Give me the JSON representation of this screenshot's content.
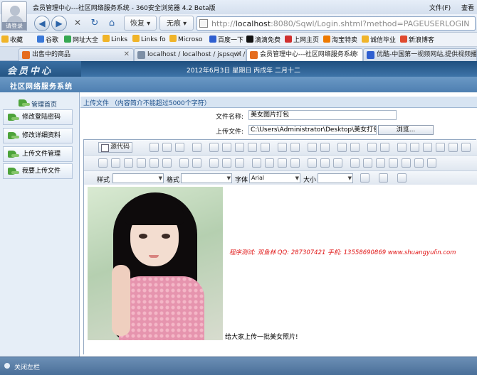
{
  "browser": {
    "title": "会员管理中心---社区网络服务系统 - 360安全浏览器 4.2 Beta版",
    "avatar_label": "请登录",
    "menu": [
      "文件(F)",
      "查看"
    ],
    "nav": {
      "back": "◀",
      "forward": "▶",
      "stop": "✕",
      "refresh": "↻",
      "home": "⌂",
      "restore_label": "恢复",
      "noimage_label": "无痕"
    },
    "url_prefix": "http://",
    "url_host": "localhost",
    "url_rest": ":8080/Sqwl/Login.shtml?method=PAGEUSERLOGIN",
    "bookmarks": [
      {
        "label": "收藏",
        "color": "#f0b429"
      },
      {
        "label": "谷歌",
        "color": "#3a78d8"
      },
      {
        "label": "网址大全",
        "color": "#36a852"
      },
      {
        "label": "Links",
        "color": "#f0b429"
      },
      {
        "label": "Links fo",
        "color": "#f0b429"
      },
      {
        "label": "Microso",
        "color": "#f0b429"
      },
      {
        "label": "百度一下",
        "color": "#2f5fd0"
      },
      {
        "label": "滴滴免费",
        "color": "#111111"
      },
      {
        "label": "上网主页",
        "color": "#d0302f"
      },
      {
        "label": "淘宝特卖",
        "color": "#ee7a00"
      },
      {
        "label": "诚信毕业",
        "color": "#f0b429"
      },
      {
        "label": "新浪博客",
        "color": "#e04a2f"
      }
    ],
    "tabs": [
      {
        "label": "出售中的商品",
        "color": "#e56d1f"
      },
      {
        "label": "localhost / localhost / jspsqwl / us",
        "color": "#7d8fa6"
      },
      {
        "label": "会员管理中心---社区网络服务系统",
        "color": "#e56d1f"
      },
      {
        "label": "优酷-中国第一视频网站,提供视频播放",
        "color": "#2f5fd0"
      }
    ]
  },
  "site": {
    "logo": "会员中心",
    "date": "2012年6月3日 星期日 丙戌年 二月十二",
    "system_title": "社区网络服务系统"
  },
  "sidebar": {
    "header": "管理首页",
    "items": [
      "修改登陆密码",
      "修改详细资料",
      "上传文件管理",
      "我要上传文件"
    ]
  },
  "form": {
    "section_title": "上传文件 （内容简介不能超过5000个字符）",
    "name_label": "文件名称:",
    "name_value": "美女图片打包",
    "upload_label": "上传文件:",
    "upload_value": "C:\\Users\\Administrator\\Desktop\\美女打包.rar",
    "browse_label": "浏览..."
  },
  "editor": {
    "source_label": "源代码",
    "style_label": "样式",
    "format_label": "格式",
    "font_label": "字体",
    "font_value": "Arial",
    "size_label": "大小",
    "sig_text": "程序测试: 双鱼林  QQ: 287307421  手机: 13558690869  www.shuangyulin.com",
    "caption": "给大家上传一批美女照片!"
  },
  "status": {
    "left_label": "关闭左栏"
  }
}
